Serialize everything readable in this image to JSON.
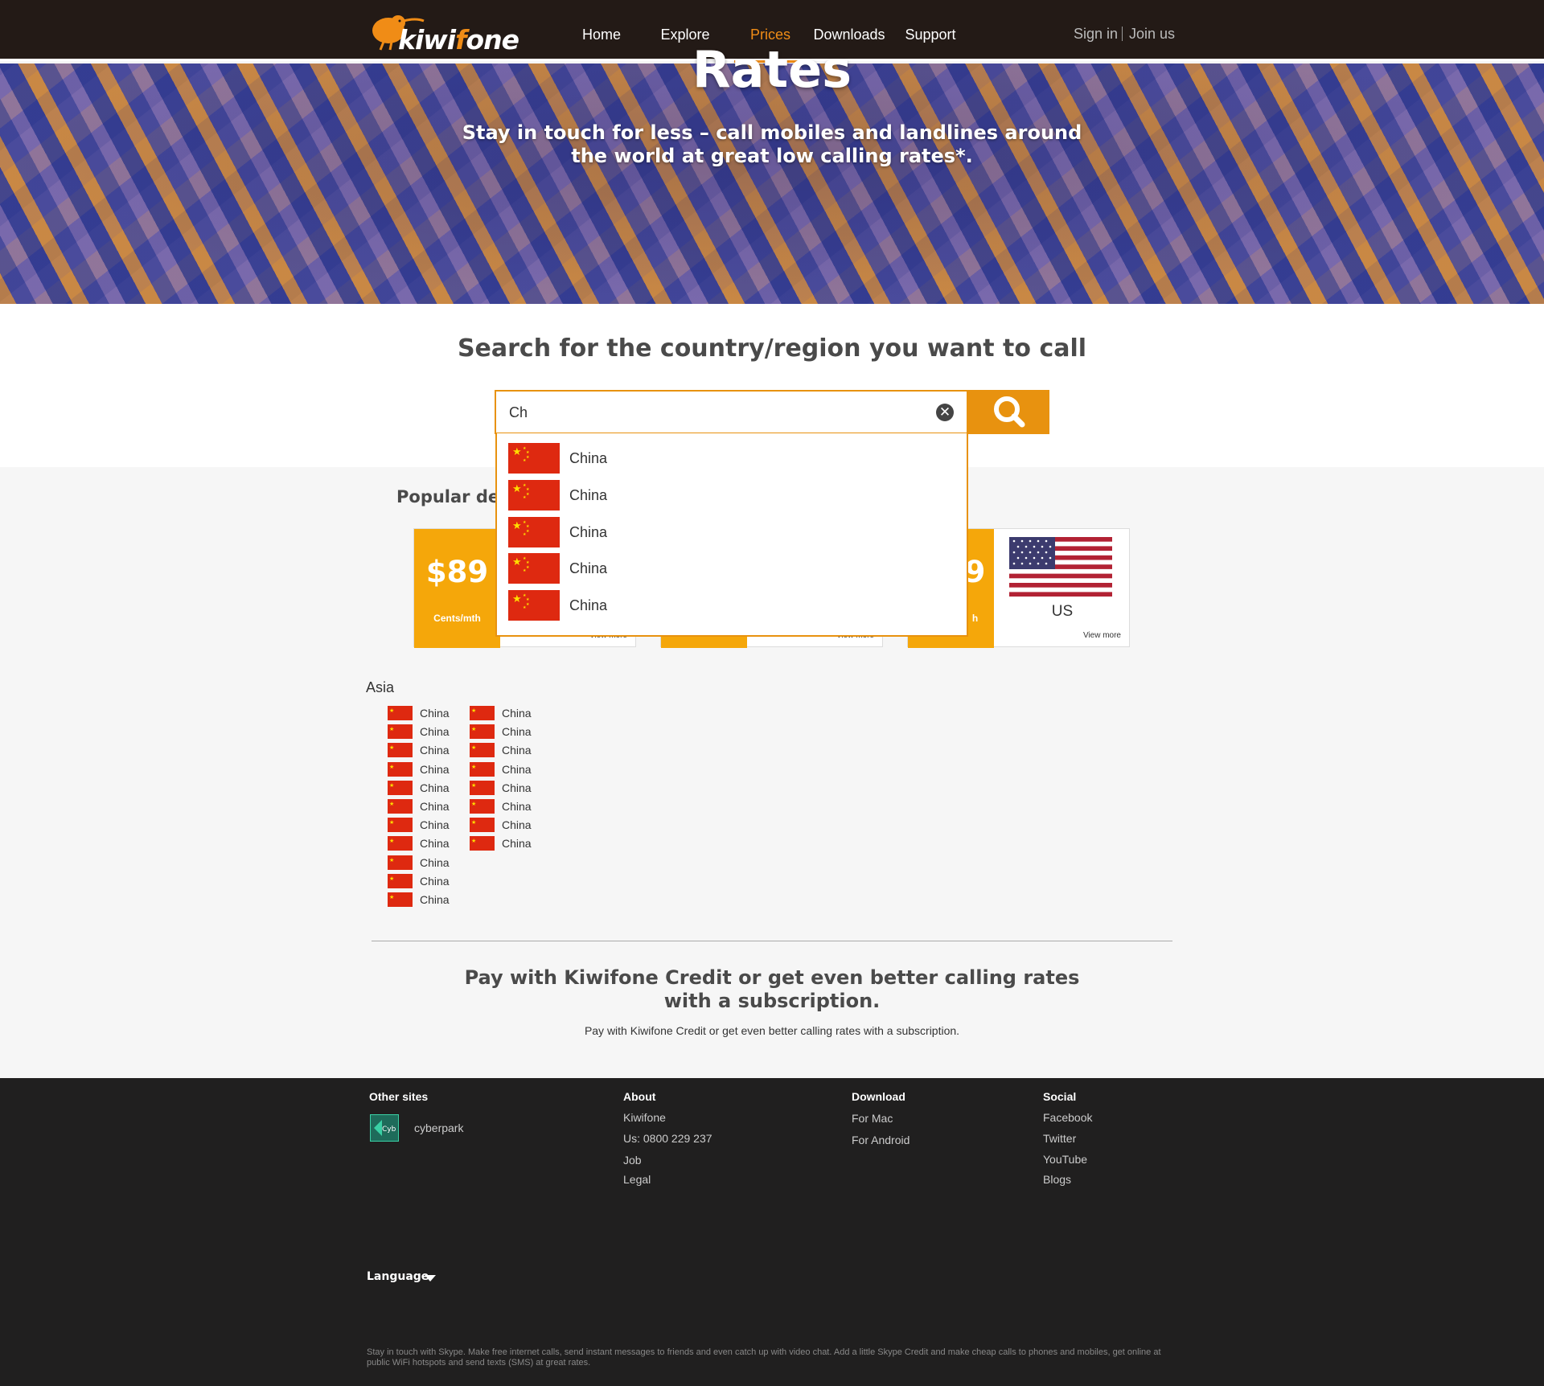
{
  "header": {
    "logo_text_a": "kiwi",
    "logo_text_f": "f",
    "logo_text_b": "one",
    "nav": [
      {
        "label": "Home"
      },
      {
        "label": "Explore"
      },
      {
        "label": "Prices"
      },
      {
        "label": "Downloads"
      },
      {
        "label": "Support"
      }
    ],
    "active_nav": "Prices",
    "sign_in": "Sign in",
    "join_us": "Join us",
    "accent_color": "#f08c16"
  },
  "hero": {
    "title": "Rates",
    "subtitle": "Stay in touch for less – call mobiles and landlines around the world at great low calling rates*."
  },
  "search": {
    "title": "Search for the country/region you want to call",
    "input_value": "Ch",
    "clear_icon": "clear-icon",
    "search_icon": "magnifier-icon",
    "suggestions": [
      {
        "name": "China",
        "flag": "china-flag"
      },
      {
        "name": "China",
        "flag": "china-flag"
      },
      {
        "name": "China",
        "flag": "china-flag"
      },
      {
        "name": "China",
        "flag": "china-flag"
      },
      {
        "name": "China",
        "flag": "china-flag"
      }
    ]
  },
  "popular": {
    "title": "Popular de",
    "cards": [
      {
        "price": "$89",
        "unit": "Cents/mth",
        "country": "",
        "more": "View more"
      },
      {
        "price": "",
        "unit": "",
        "country": "",
        "more": "View more"
      },
      {
        "price": "9",
        "unit": "h",
        "country": "US",
        "more": "View more"
      }
    ]
  },
  "asia": {
    "label": "Asia",
    "col1": [
      "China",
      "China",
      "China",
      "China",
      "China",
      "China",
      "China",
      "China",
      "China",
      "China",
      "China"
    ],
    "col2": [
      "China",
      "China",
      "China",
      "China",
      "China",
      "China",
      "China",
      "China"
    ]
  },
  "pay": {
    "title": "Pay with Kiwifone Credit or get even better calling rates with a subscription.",
    "subtitle": "Pay with Kiwifone Credit or get even better calling rates with a subscription."
  },
  "footer": {
    "other_sites": {
      "heading": "Other sites",
      "items": [
        "cyberpark"
      ],
      "logo_text": "Cyb"
    },
    "about": {
      "heading": "About",
      "items": [
        "Kiwifone",
        "Us: 0800 229 237",
        "Job",
        "Legal"
      ]
    },
    "download": {
      "heading": "Download",
      "items": [
        "For Mac",
        "For Android"
      ]
    },
    "social": {
      "heading": "Social",
      "items": [
        "Facebook",
        "Twitter",
        "YouTube",
        "Blogs"
      ]
    },
    "language": "Language",
    "fine_print": "Stay in touch with Skype. Make free internet calls, send instant messages to friends and even catch up with video chat. Add a little Skype Credit and make cheap calls to phones and mobiles, get online at public WiFi hotspots and send texts (SMS) at great rates."
  }
}
